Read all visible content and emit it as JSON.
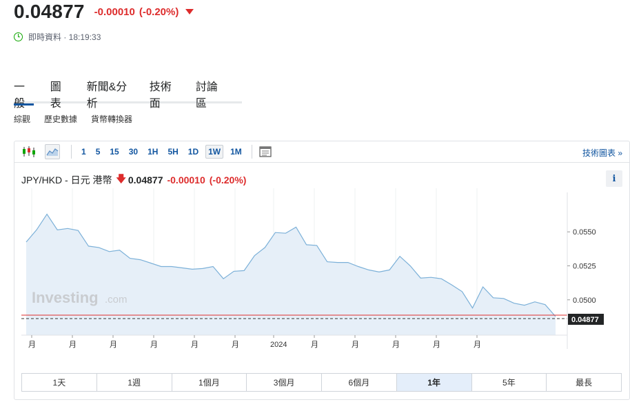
{
  "quote": {
    "price": "0.04877",
    "change": "-0.00010",
    "change_pct": "(-0.20%)",
    "status_text": "即時資料 · 18:19:33"
  },
  "main_tabs": [
    "一般",
    "圖表",
    "新聞&分析",
    "技術面",
    "討論區"
  ],
  "sub_tabs": [
    "綜觀",
    "歷史數據",
    "貨幣轉換器"
  ],
  "toolbar": {
    "intervals": [
      "1",
      "5",
      "15",
      "30",
      "1H",
      "5H",
      "1D",
      "1W",
      "1M"
    ],
    "selected_interval": "1W",
    "tech_chart_link": "技術圖表 »"
  },
  "chart_header": {
    "name": "JPY/HKD - 日元 港幣",
    "price": "0.04877",
    "change": "-0.00010",
    "change_pct": "(-0.20%)",
    "info_label": "i"
  },
  "watermark": {
    "brand": "Investing",
    "suffix": ".com"
  },
  "ranges": [
    "1天",
    "1週",
    "1個月",
    "3個月",
    "6個月",
    "1年",
    "5年",
    "最長"
  ],
  "active_range": "1年",
  "colors": {
    "line": "#7bb0d8",
    "area": "#e6eff8",
    "down": "#dd2c2c",
    "accent": "#1256a0",
    "last_price_tag": "#232526"
  },
  "chart_data": {
    "type": "area",
    "y_ticks": [
      "0.0550",
      "0.0525",
      "0.0500"
    ],
    "ylim": [
      0.0474,
      0.0577
    ],
    "x_tick_labels": [
      "月",
      "月",
      "月",
      "月",
      "月",
      "月",
      "2024",
      "月",
      "月",
      "月",
      "月",
      "月"
    ],
    "last_price_label": "0.04877",
    "reference_line": 0.04887,
    "values": [
      0.05425,
      0.05515,
      0.0563,
      0.05515,
      0.05525,
      0.0551,
      0.05395,
      0.05385,
      0.05355,
      0.05365,
      0.05305,
      0.05295,
      0.0527,
      0.05245,
      0.05245,
      0.05235,
      0.05225,
      0.0523,
      0.05245,
      0.05155,
      0.0521,
      0.05215,
      0.05325,
      0.05385,
      0.05495,
      0.0549,
      0.05535,
      0.05405,
      0.054,
      0.0528,
      0.05275,
      0.05275,
      0.05245,
      0.0522,
      0.05205,
      0.0522,
      0.0532,
      0.0525,
      0.0516,
      0.05165,
      0.05155,
      0.0511,
      0.0506,
      0.0494,
      0.05095,
      0.05015,
      0.0501,
      0.04975,
      0.0496,
      0.04985,
      0.04965,
      0.04877
    ],
    "grid": true
  }
}
